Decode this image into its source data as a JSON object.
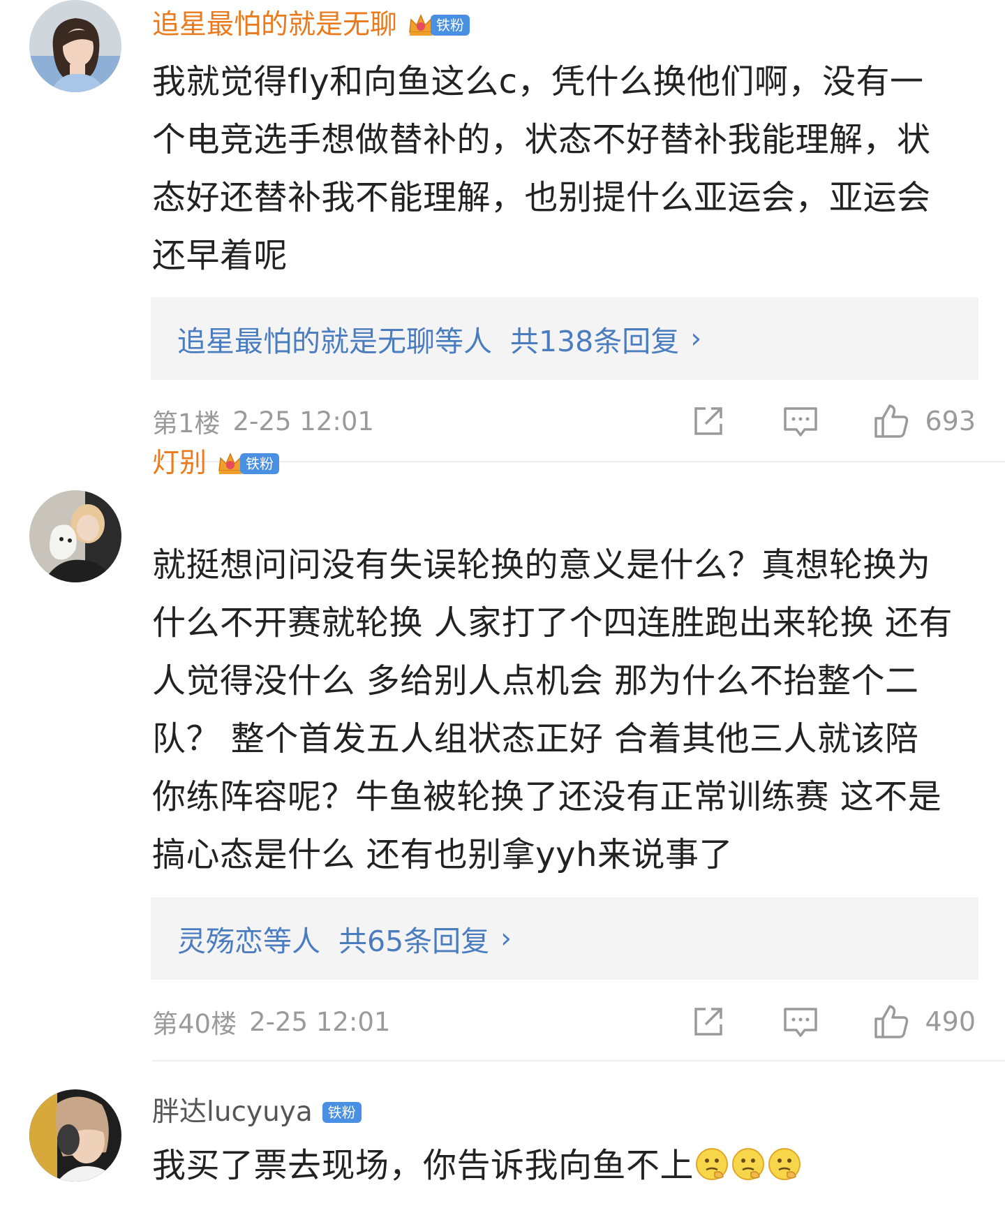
{
  "comments": [
    {
      "username": "追星最怕的就是无聊",
      "badge": "铁粉",
      "lines": [
        "我就觉得fly和向鱼这么c，凭什么换他们啊，没有一",
        "个电竞选手想做替补的，状态不好替补我能理解，状",
        "态好还替补我不能理解，也别提什么亚运会，亚运会",
        "还早着呢"
      ],
      "replies_names": "追星最怕的就是无聊",
      "replies_etc": "等人",
      "replies_count": "共138条回复",
      "replies_chevron": "›",
      "floor": "第1楼",
      "time": "2-25 12:01",
      "likes": "693"
    },
    {
      "username": "灯别",
      "badge": "铁粉",
      "lines": [
        "就挺想问问没有失误轮换的意义是什么？真想轮换为",
        "什么不开赛就轮换 人家打了个四连胜跑出来轮换 还有",
        "人觉得没什么 多给别人点机会 那为什么不抬整个二",
        "队？ 整个首发五人组状态正好 合着其他三人就该陪",
        "你练阵容呢？牛鱼被轮换了还没有正常训练赛 这不是",
        "搞心态是什么  还有也别拿yyh来说事了"
      ],
      "replies_names": "灵殇恋",
      "replies_etc": "等人",
      "replies_count": "共65条回复",
      "replies_chevron": "›",
      "floor": "第40楼",
      "time": "2-25 12:01",
      "likes": "490"
    },
    {
      "username": "胖达lucyuya",
      "badge": "铁粉",
      "line": "我买了票去现场，你告诉我向鱼不上"
    }
  ],
  "colors": {
    "username_vip": "#eb7a1c",
    "username_normal": "#555555",
    "link_blue": "#4a7cc0",
    "badge_blue": "#4a90e2",
    "reply_bg": "#f4f4f4",
    "meta_gray": "#9a9a9a"
  },
  "icons": {
    "crown": "crown-icon",
    "share": "share-icon",
    "comment": "comment-icon",
    "like": "thumbs-up-icon",
    "emoji": "thinking-face-emoji"
  }
}
